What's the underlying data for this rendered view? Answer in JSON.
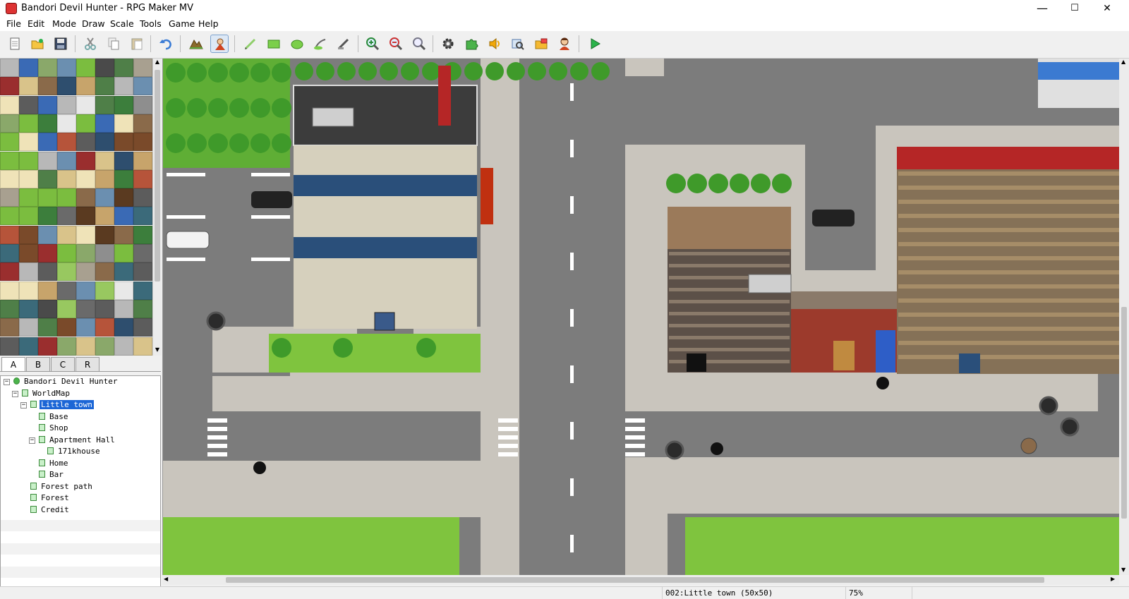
{
  "window": {
    "title": "Bandori Devil Hunter - RPG Maker MV",
    "minimize": "—",
    "maximize": "☐",
    "close": "✕"
  },
  "menu": [
    "File",
    "Edit",
    "Mode",
    "Draw",
    "Scale",
    "Tools",
    "Game",
    "Help"
  ],
  "toolbar": {
    "icons": [
      "new-project-icon",
      "open-project-icon",
      "save-project-icon",
      "cut-icon",
      "copy-icon",
      "paste-icon",
      "undo-icon",
      "map-mode-icon",
      "event-mode-icon",
      "pencil-icon",
      "rectangle-icon",
      "ellipse-icon",
      "fill-icon",
      "shadow-pen-icon",
      "zoom-in-icon",
      "zoom-out-icon",
      "actual-size-icon",
      "database-icon",
      "plugin-manager-icon",
      "sound-test-icon",
      "event-searcher-icon",
      "resource-manager-icon",
      "character-generator-icon",
      "playtest-icon"
    ],
    "active": "event-mode-icon"
  },
  "tileset_tabs": [
    "A",
    "B",
    "C",
    "R"
  ],
  "selected_tab": "A",
  "map_tree": [
    {
      "label": "Bandori Devil Hunter",
      "depth": 0,
      "kind": "project",
      "expander": "−"
    },
    {
      "label": "WorldMap",
      "depth": 1,
      "kind": "map",
      "expander": "−"
    },
    {
      "label": "Little town",
      "depth": 2,
      "kind": "map",
      "expander": "−",
      "selected": true
    },
    {
      "label": "Base",
      "depth": 3,
      "kind": "map"
    },
    {
      "label": "Shop",
      "depth": 3,
      "kind": "map"
    },
    {
      "label": "Apartment Hall",
      "depth": 3,
      "kind": "map",
      "expander": "−"
    },
    {
      "label": "171khouse",
      "depth": 4,
      "kind": "map"
    },
    {
      "label": "Home",
      "depth": 3,
      "kind": "map"
    },
    {
      "label": "Bar",
      "depth": 3,
      "kind": "map"
    },
    {
      "label": "Forest path",
      "depth": 2,
      "kind": "map"
    },
    {
      "label": "Forest",
      "depth": 2,
      "kind": "map"
    },
    {
      "label": "Credit",
      "depth": 2,
      "kind": "map"
    }
  ],
  "status": {
    "map_info": "002:Little town (50x50)",
    "zoom": "75%"
  },
  "colors": {
    "selection": "#1c66d6",
    "road": "#7c7c7c",
    "sidewalk": "#c9c5bd",
    "grass": "#7fc43e",
    "tree": "#3f9a2a",
    "roof_red": "#b52626",
    "brick": "#9c3a2c",
    "window_blue": "#2a4f7a"
  }
}
